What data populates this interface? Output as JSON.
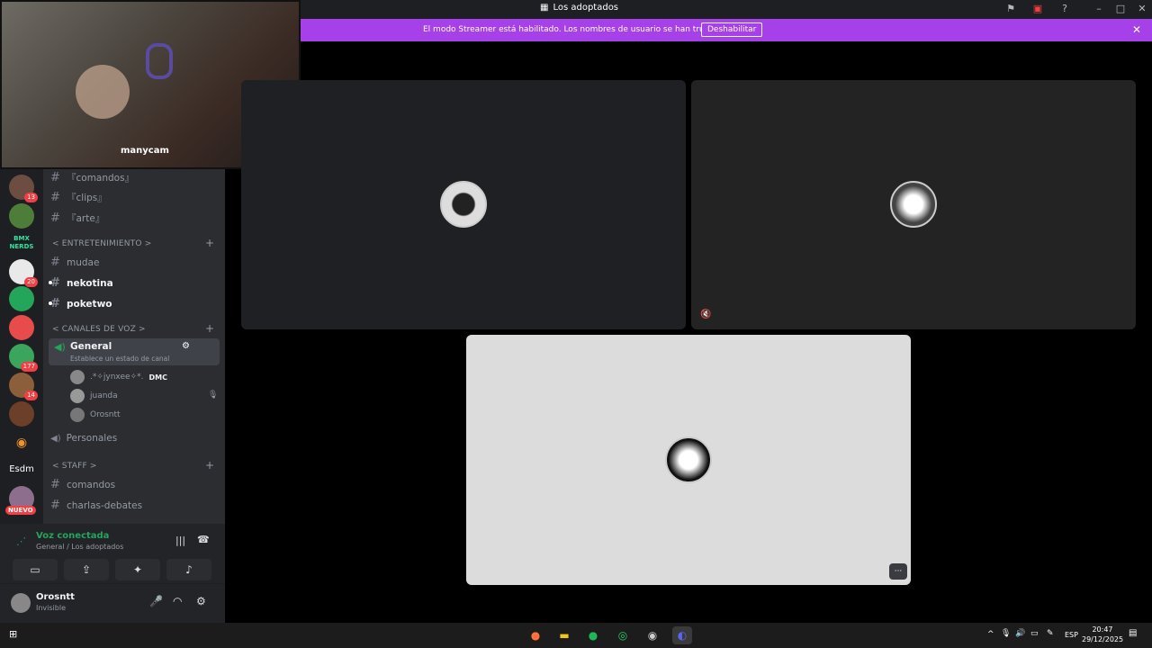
{
  "window": {
    "title": "Los adoptados"
  },
  "banner": {
    "message": "El modo Streamer está habilitado. Los nombres de usuario se han truncado.",
    "button": "Deshabilitar"
  },
  "camera": {
    "watermark": "manycam"
  },
  "servers": [
    {
      "badge": "13"
    },
    {
      "badge": ""
    },
    {
      "label": "BMX NERDS",
      "badge": ""
    },
    {
      "badge": "20"
    },
    {
      "badge": ""
    },
    {
      "badge": ""
    },
    {
      "badge": "177"
    },
    {
      "badge": "14"
    },
    {
      "badge": ""
    },
    {
      "badge": ""
    },
    {
      "label": "Esdm",
      "badge": ""
    },
    {
      "badge": "NUEVO"
    }
  ],
  "channels": {
    "top": [
      {
        "label": "『comandos』"
      },
      {
        "label": "『clips』"
      },
      {
        "label": "『arte』"
      }
    ],
    "cat_entretenimiento": "< ENTRETENIMIENTO >",
    "entretenimiento": [
      {
        "label": "mudae",
        "unread": false
      },
      {
        "label": "nekotina",
        "unread": true
      },
      {
        "label": "poketwo",
        "unread": true
      }
    ],
    "cat_voz": "< CANALES DE VOZ >",
    "voice_general": "General",
    "voice_status": "Establece un estado de canal",
    "voice_users": [
      {
        "name": ".*✧jynxee✧*.",
        "tag": "DMC"
      },
      {
        "name": "juanda",
        "tag": ""
      },
      {
        "name": "Orosntt",
        "tag": ""
      }
    ],
    "voice_personales": "Personales",
    "cat_staff": "< STAFF >",
    "staff": [
      {
        "label": "comandos"
      },
      {
        "label": "charlas-debates"
      }
    ]
  },
  "voice_panel": {
    "status": "Voz conectada",
    "location": "General / Los adoptados"
  },
  "user": {
    "name": "Orosntt",
    "status": "Invisible"
  },
  "taskbar": {
    "time": "20:47",
    "date": "29/12/2025",
    "lang": "ESP"
  },
  "colors": {
    "accent": "#a640e8",
    "voice_green": "#23a55a"
  }
}
